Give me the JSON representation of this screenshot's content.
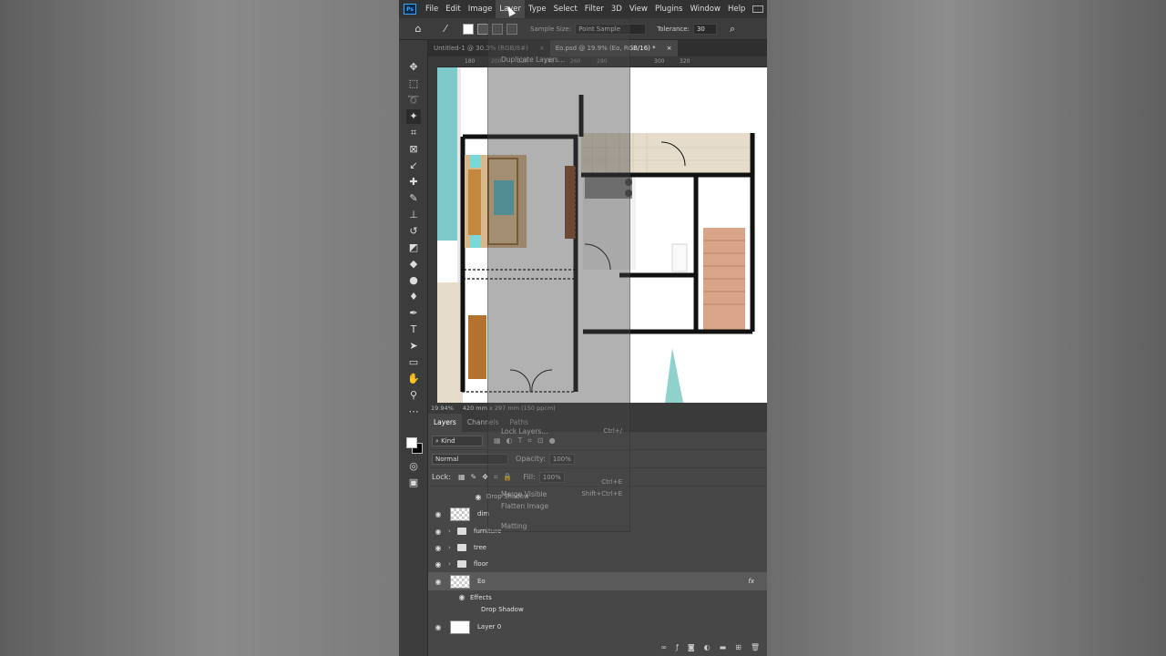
{
  "menubar": {
    "items": [
      "File",
      "Edit",
      "Image",
      "Layer",
      "Type",
      "Select",
      "Filter",
      "3D",
      "View",
      "Plugins",
      "Window",
      "Help"
    ],
    "active": "Layer"
  },
  "options": {
    "sample_size_label": "Sample Size:",
    "sample_size_value": "Point Sample",
    "tolerance_label": "Tolerance:",
    "tolerance_value": "30"
  },
  "tabs": [
    "Untitled-1 @ 30.3% (RGB/8#)",
    "Eo.psd @ 19.9% (Eo, RGB/16) *"
  ],
  "ruler": [
    "180",
    "200",
    "220",
    "240",
    "260",
    "280",
    "300",
    "320"
  ],
  "status": {
    "zoom": "19.94%",
    "doc": "420 mm x 297 mm (150 ppcm)"
  },
  "layer_menu": {
    "top_item": "Duplicate Layers...",
    "visible_items": [
      "Lock Layers...",
      "Merge Visible",
      "Flatten Image",
      "Matting"
    ],
    "shortcuts": [
      "Ctrl+/",
      "Ctrl+E",
      "Shift+Ctrl+E"
    ]
  },
  "panel": {
    "tabs": [
      "Layers",
      "Channels",
      "Paths"
    ],
    "kind": "Kind",
    "blend": "Normal",
    "opacity_label": "Opacity:",
    "opacity": "100%",
    "lock_label": "Lock:",
    "fill_label": "Fill:",
    "fill": "100%"
  },
  "layers": {
    "drop_shadow_top": "Drop Shadow",
    "dim": "dim",
    "furniture": "furniture",
    "tree": "tree",
    "floor": "floor",
    "eo": "Eo",
    "effects": "Effects",
    "drop_shadow": "Drop Shadow",
    "layer0": "Layer 0",
    "fx": "fx"
  },
  "colors": {
    "ps_blue": "#31a8ff",
    "teal": "#7ec9c9",
    "tile": "#e6dccb",
    "wood": "#d9a488"
  }
}
